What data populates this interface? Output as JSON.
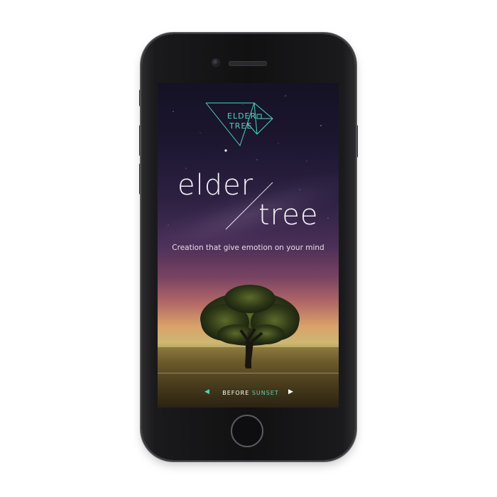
{
  "logo": {
    "line1": "ELDER",
    "line2": "TREE",
    "color": "#4fd3bd"
  },
  "brand": {
    "word1": "elder",
    "word2": "tree"
  },
  "tagline": "Creation that give emotion on your mind",
  "nav": {
    "prev_icon": "chevron-left-icon",
    "next_icon": "chevron-right-icon",
    "label_before": "BEFORE",
    "label_sunset": "SUNSET",
    "accent": "#4fd3bd"
  },
  "device": {
    "type": "smartphone",
    "color": "#111112"
  }
}
